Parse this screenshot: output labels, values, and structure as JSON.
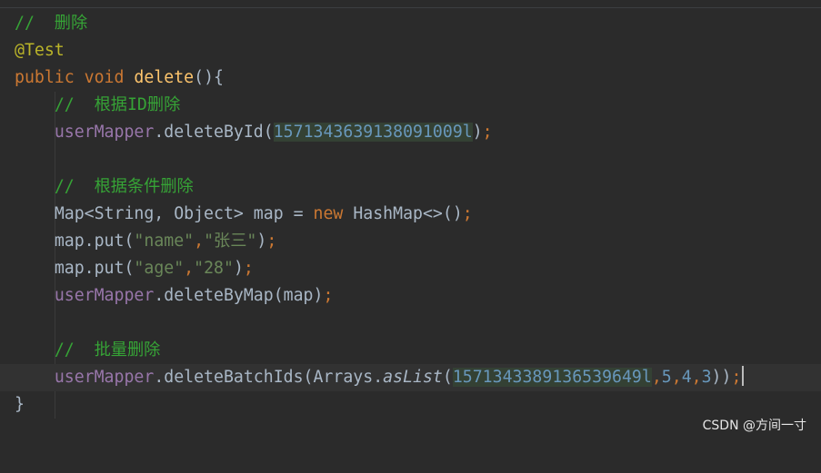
{
  "code": {
    "line1": {
      "comment": "//  删除"
    },
    "line2": {
      "annotation": "@Test"
    },
    "line3": {
      "kw_public": "public",
      "kw_void": "void",
      "method": "delete",
      "rest": "(){"
    },
    "line4": {
      "comment": "//  根据ID删除"
    },
    "line5": {
      "field": "userMapper",
      "call": ".deleteById(",
      "arg": "1571343639138091009l",
      "close": ")",
      "semi": ";"
    },
    "line7": {
      "comment": "//  根据条件删除"
    },
    "line8": {
      "decl": "Map<String, Object> map = ",
      "kw_new": "new",
      "ctor": " HashMap<>()",
      "semi": ";"
    },
    "line9": {
      "pre": "map.put(",
      "s1": "\"name\"",
      "comma": ",",
      "s2": "\"张三\"",
      "close": ")",
      "semi": ";"
    },
    "line10": {
      "pre": "map.put(",
      "s1": "\"age\"",
      "comma": ",",
      "s2": "\"28\"",
      "close": ")",
      "semi": ";"
    },
    "line11": {
      "field": "userMapper",
      "call": ".deleteByMap(map)",
      "semi": ";"
    },
    "line13": {
      "comment": "//  批量删除"
    },
    "line14": {
      "field": "userMapper",
      "call": ".deleteBatchIds(Arrays.",
      "as_list": "asList",
      "open": "(",
      "arg1": "1571343389136539649l",
      "c1": ",",
      "arg2": "5",
      "c2": ",",
      "arg3": "4",
      "c3": ",",
      "arg4": "3",
      "close": "))",
      "semi": ";"
    },
    "line15": {
      "brace": "}"
    }
  },
  "watermark": "CSDN @方间一寸",
  "colors": {
    "background": "#2b2b2b",
    "comment": "#36a336",
    "annotation": "#bbb529",
    "keyword": "#cc7832",
    "method": "#ffc66d",
    "field": "#9876aa",
    "number": "#6897bb",
    "string": "#6a8759",
    "text": "#a9b7c6"
  }
}
